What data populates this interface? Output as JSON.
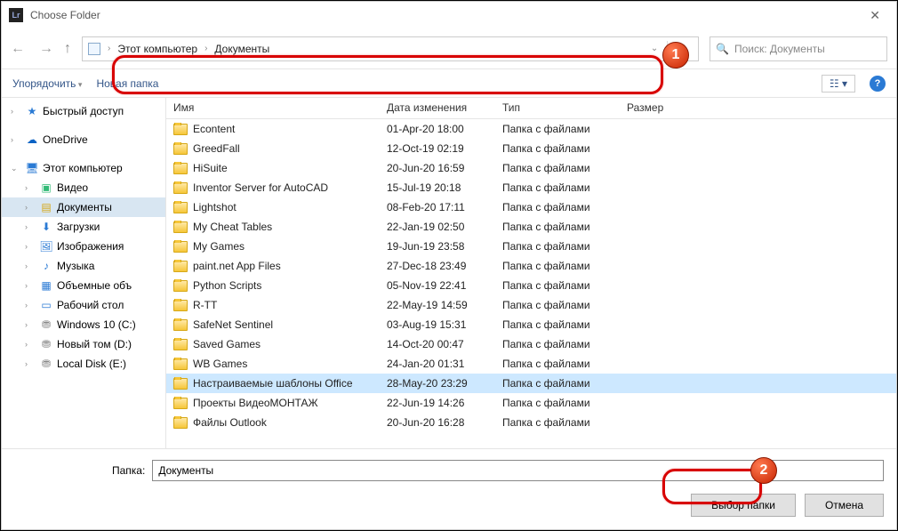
{
  "window": {
    "title": "Choose Folder"
  },
  "breadcrumb": {
    "root": "Этот компьютер",
    "current": "Документы"
  },
  "search": {
    "placeholder": "Поиск: Документы"
  },
  "toolbar": {
    "organize": "Упорядочить",
    "newfolder": "Новая папка"
  },
  "columns": {
    "name": "Имя",
    "date": "Дата изменения",
    "type": "Тип",
    "size": "Размер"
  },
  "sidebar": {
    "quick": "Быстрый доступ",
    "onedrive": "OneDrive",
    "thispc": "Этот компьютер",
    "items": [
      {
        "label": "Видео"
      },
      {
        "label": "Документы"
      },
      {
        "label": "Загрузки"
      },
      {
        "label": "Изображения"
      },
      {
        "label": "Музыка"
      },
      {
        "label": "Объемные объ"
      },
      {
        "label": "Рабочий стол"
      },
      {
        "label": "Windows 10 (C:)"
      },
      {
        "label": "Новый том (D:)"
      },
      {
        "label": "Local Disk (E:)"
      }
    ]
  },
  "typelabel": "Папка с файлами",
  "files": [
    {
      "name": "Econtent",
      "date": "01-Apr-20 18:00"
    },
    {
      "name": "GreedFall",
      "date": "12-Oct-19 02:19"
    },
    {
      "name": "HiSuite",
      "date": "20-Jun-20 16:59"
    },
    {
      "name": "Inventor Server for AutoCAD",
      "date": "15-Jul-19 20:18"
    },
    {
      "name": "Lightshot",
      "date": "08-Feb-20 17:11"
    },
    {
      "name": "My Cheat Tables",
      "date": "22-Jan-19 02:50"
    },
    {
      "name": "My Games",
      "date": "19-Jun-19 23:58"
    },
    {
      "name": "paint.net App Files",
      "date": "27-Dec-18 23:49"
    },
    {
      "name": "Python Scripts",
      "date": "05-Nov-19 22:41"
    },
    {
      "name": "R-TT",
      "date": "22-May-19 14:59"
    },
    {
      "name": "SafeNet Sentinel",
      "date": "03-Aug-19 15:31"
    },
    {
      "name": "Saved Games",
      "date": "14-Oct-20 00:47"
    },
    {
      "name": "WB Games",
      "date": "24-Jan-20 01:31"
    },
    {
      "name": "Настраиваемые шаблоны Office",
      "date": "28-May-20 23:29",
      "selected": true
    },
    {
      "name": "Проекты ВидеоМОНТАЖ",
      "date": "22-Jun-19 14:26"
    },
    {
      "name": "Файлы Outlook",
      "date": "20-Jun-20 16:28"
    }
  ],
  "footer": {
    "label": "Папка:",
    "value": "Документы",
    "choose": "Выбор папки",
    "cancel": "Отмена"
  },
  "annotations": {
    "step1": "1",
    "step2": "2"
  }
}
